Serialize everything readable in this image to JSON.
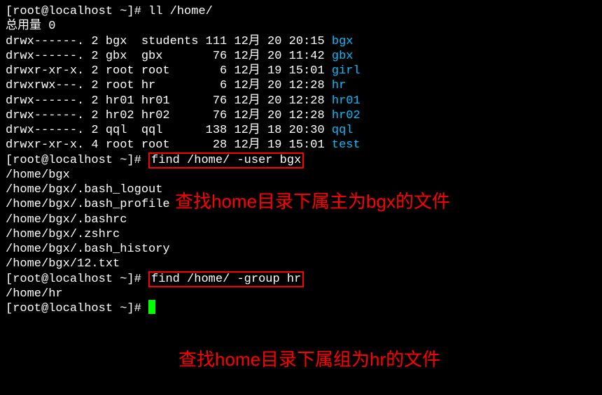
{
  "prompt": "[root@localhost ~]# ",
  "cmd1": "ll /home/",
  "totalLine": "总用量 0",
  "listing": [
    {
      "perms": "drwx------. 2 bgx  students 111 12月 20 20:15 ",
      "name": "bgx"
    },
    {
      "perms": "drwx------. 2 gbx  gbx       76 12月 20 11:42 ",
      "name": "gbx"
    },
    {
      "perms": "drwxr-xr-x. 2 root root       6 12月 19 15:01 ",
      "name": "girl"
    },
    {
      "perms": "drwxrwx---. 2 root hr         6 12月 20 12:28 ",
      "name": "hr"
    },
    {
      "perms": "drwx------. 2 hr01 hr01      76 12月 20 12:28 ",
      "name": "hr01"
    },
    {
      "perms": "drwx------. 2 hr02 hr02      76 12月 20 12:28 ",
      "name": "hr02"
    },
    {
      "perms": "drwx------. 2 qql  qql      138 12月 18 20:30 ",
      "name": "qql"
    },
    {
      "perms": "drwxr-xr-x. 4 root root      28 12月 19 15:01 ",
      "name": "test"
    }
  ],
  "cmd2": "find /home/ -user bgx",
  "results1": [
    "/home/bgx",
    "/home/bgx/.bash_logout",
    "/home/bgx/.bash_profile",
    "/home/bgx/.bashrc",
    "/home/bgx/.zshrc",
    "/home/bgx/.bash_history",
    "/home/bgx/12.txt"
  ],
  "cmd3": "find /home/ -group hr",
  "results2": [
    "/home/hr"
  ],
  "annotation1": "查找home目录下属主为bgx的文件",
  "annotation2": "查找home目录下属组为hr的文件"
}
